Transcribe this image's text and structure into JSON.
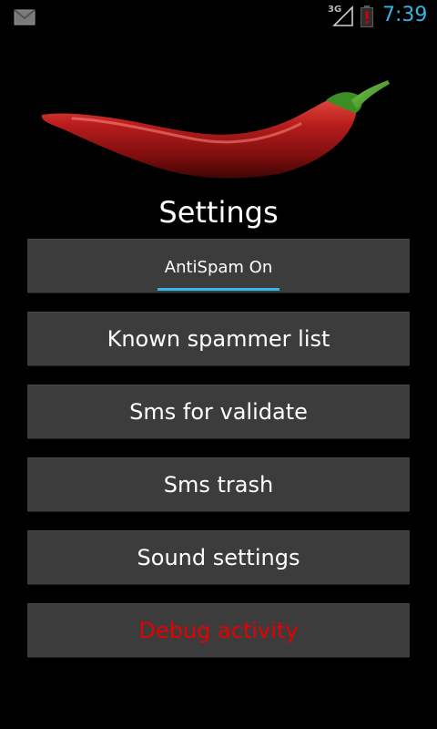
{
  "status_bar": {
    "time": "7:39",
    "network_type": "3G",
    "icons": [
      "mail-icon",
      "signal-icon",
      "battery-alert-icon"
    ],
    "colors": {
      "clock": "#33b5e5",
      "battery_alert": "#d40000"
    }
  },
  "header": {
    "title": "Settings",
    "image": "red-chili-pepper-image"
  },
  "menu": {
    "toggle": {
      "label": "AntiSpam On",
      "state": "on",
      "indicator_color": "#33b5e5"
    },
    "items": [
      {
        "label": "Known spammer list"
      },
      {
        "label": "Sms for validate"
      },
      {
        "label": "Sms trash"
      },
      {
        "label": "Sound settings"
      },
      {
        "label": "Debug activity",
        "color": "#e60000"
      }
    ]
  }
}
